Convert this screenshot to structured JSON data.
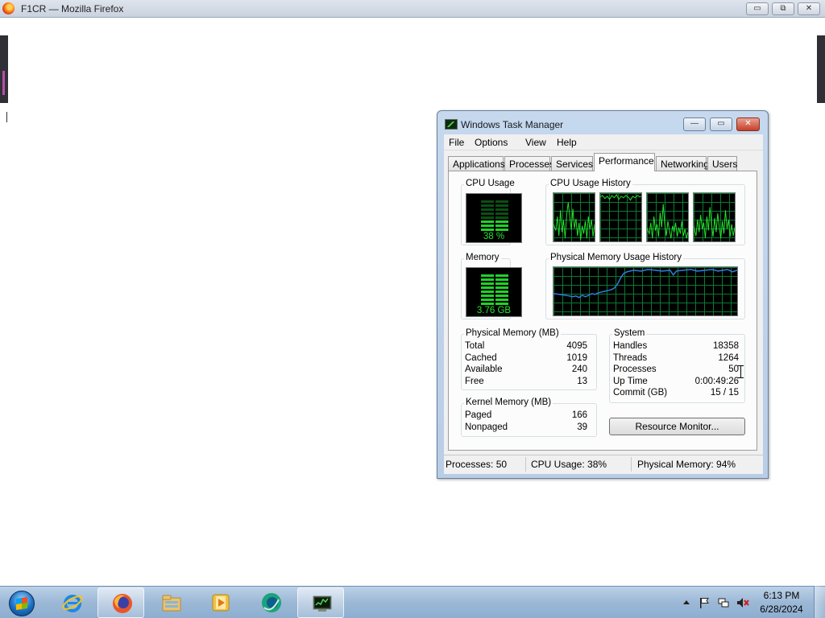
{
  "firefox": {
    "window_title": "F1CR — Mozilla Firefox",
    "controls": {
      "minimize": "▭",
      "restore": "⧉",
      "close": "✕"
    }
  },
  "task_manager": {
    "title": "Windows Task Manager",
    "controls": {
      "minimize": "—",
      "maximize": "▭",
      "close": "✕"
    },
    "menu": [
      "File",
      "Options",
      "View",
      "Help"
    ],
    "tabs": [
      "Applications",
      "Processes",
      "Services",
      "Performance",
      "Networking",
      "Users"
    ],
    "active_tab": "Performance",
    "cpu_usage": {
      "label": "CPU Usage",
      "value": "38 %",
      "percent": 38
    },
    "cpu_history": {
      "label": "CPU Usage History"
    },
    "memory": {
      "label": "Memory",
      "value": "3.76 GB",
      "percent": 94
    },
    "memory_history": {
      "label": "Physical Memory Usage History"
    },
    "physical_memory": {
      "label": "Physical Memory (MB)",
      "rows": [
        {
          "key": "Total",
          "value": "4095"
        },
        {
          "key": "Cached",
          "value": "1019"
        },
        {
          "key": "Available",
          "value": "240"
        },
        {
          "key": "Free",
          "value": "13"
        }
      ]
    },
    "kernel_memory": {
      "label": "Kernel Memory (MB)",
      "rows": [
        {
          "key": "Paged",
          "value": "166"
        },
        {
          "key": "Nonpaged",
          "value": "39"
        }
      ]
    },
    "system": {
      "label": "System",
      "rows": [
        {
          "key": "Handles",
          "value": "18358"
        },
        {
          "key": "Threads",
          "value": "1264"
        },
        {
          "key": "Processes",
          "value": "50"
        },
        {
          "key": "Up Time",
          "value": "0:00:49:26"
        },
        {
          "key": "Commit (GB)",
          "value": "15 / 15"
        }
      ]
    },
    "resource_monitor_button": "Resource Monitor...",
    "status": {
      "processes": "Processes: 50",
      "cpu": "CPU Usage: 38%",
      "memory": "Physical Memory: 94%"
    }
  },
  "taskbar": {
    "pinned": [
      "internet-explorer-icon",
      "firefox-icon",
      "file-explorer-icon",
      "media-player-icon",
      "app-icon",
      "task-manager-icon"
    ],
    "clock": {
      "time": "6:13 PM",
      "date": "6/28/2024"
    }
  },
  "colors": {
    "graph_line": "#26e42e",
    "graph_grid": "#0b7a30",
    "memory_line": "#2f7fe0"
  }
}
